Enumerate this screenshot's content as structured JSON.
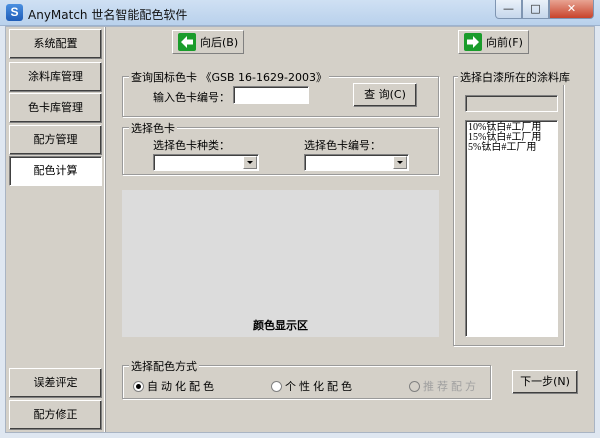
{
  "window": {
    "title": "AnyMatch 世名智能配色软件",
    "icon_letter": "S",
    "minimize": "—",
    "maximize": "□",
    "close": "✕"
  },
  "nav": {
    "items": [
      {
        "label": "系统配置",
        "active": false
      },
      {
        "label": "涂料库管理",
        "active": false
      },
      {
        "label": "色卡库管理",
        "active": false
      },
      {
        "label": "配方管理",
        "active": false
      },
      {
        "label": "配色计算",
        "active": true
      }
    ],
    "bottom": [
      {
        "label": "误差评定"
      },
      {
        "label": "配方修正"
      }
    ]
  },
  "toolbar": {
    "back_label": "向后(B)",
    "forward_label": "向前(F)"
  },
  "query": {
    "group_title": "查询国标色卡  《GSB 16-1629-2003》",
    "code_label": "输入色卡编号：",
    "code_value": "",
    "search_button": "查  询(C)"
  },
  "select_card": {
    "group_title": "选择色卡",
    "type_label": "选择色卡种类：",
    "type_value": "",
    "number_label": "选择色卡编号：",
    "number_value": ""
  },
  "color_display": {
    "label": "颜色显示区",
    "color": "#dcdcdc"
  },
  "library": {
    "group_title": "选择白漆所在的涂料库",
    "selected_value": "",
    "items": [
      "10%钛白#工厂用",
      "15%钛白#工厂用",
      "5%钛白#工厂用"
    ]
  },
  "method": {
    "group_title": "选择配色方式",
    "options": [
      {
        "label": "自动化配色",
        "checked": true,
        "enabled": true
      },
      {
        "label": "个性化配色",
        "checked": false,
        "enabled": true
      },
      {
        "label": "推荐配方",
        "checked": false,
        "enabled": false
      }
    ],
    "next_button": "下一步(N)"
  }
}
